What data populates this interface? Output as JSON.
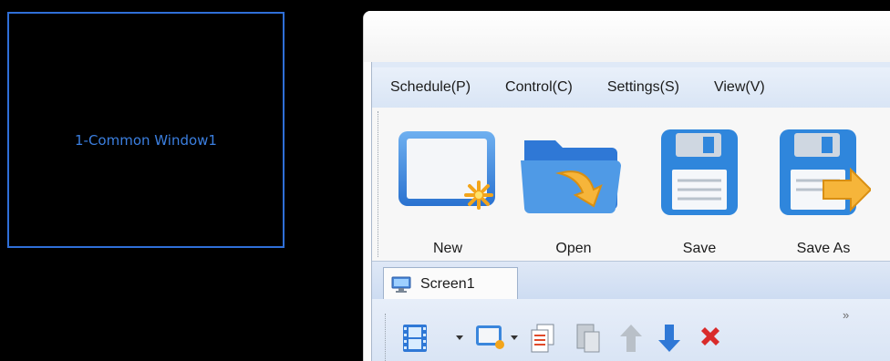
{
  "preview": {
    "window_label": "1-Common Window1"
  },
  "menu": {
    "items": [
      "Schedule(P)",
      "Control(C)",
      "Settings(S)",
      "View(V)"
    ]
  },
  "toolbar": {
    "new_label": "New",
    "open_label": "Open",
    "save_label": "Save",
    "saveas_label": "Save As"
  },
  "tabs": [
    {
      "label": "Screen1",
      "icon": "monitor-icon"
    }
  ],
  "subtoolbar": {
    "more": "»",
    "icons": [
      "video-icon",
      "window-add-icon",
      "copy-icon",
      "paste-icon",
      "move-up-icon",
      "move-down-icon",
      "delete-icon"
    ]
  },
  "colors": {
    "accent_blue": "#2f6fd8",
    "menu_bg": "#dfe9f7",
    "delete_red": "#d92b2b"
  }
}
